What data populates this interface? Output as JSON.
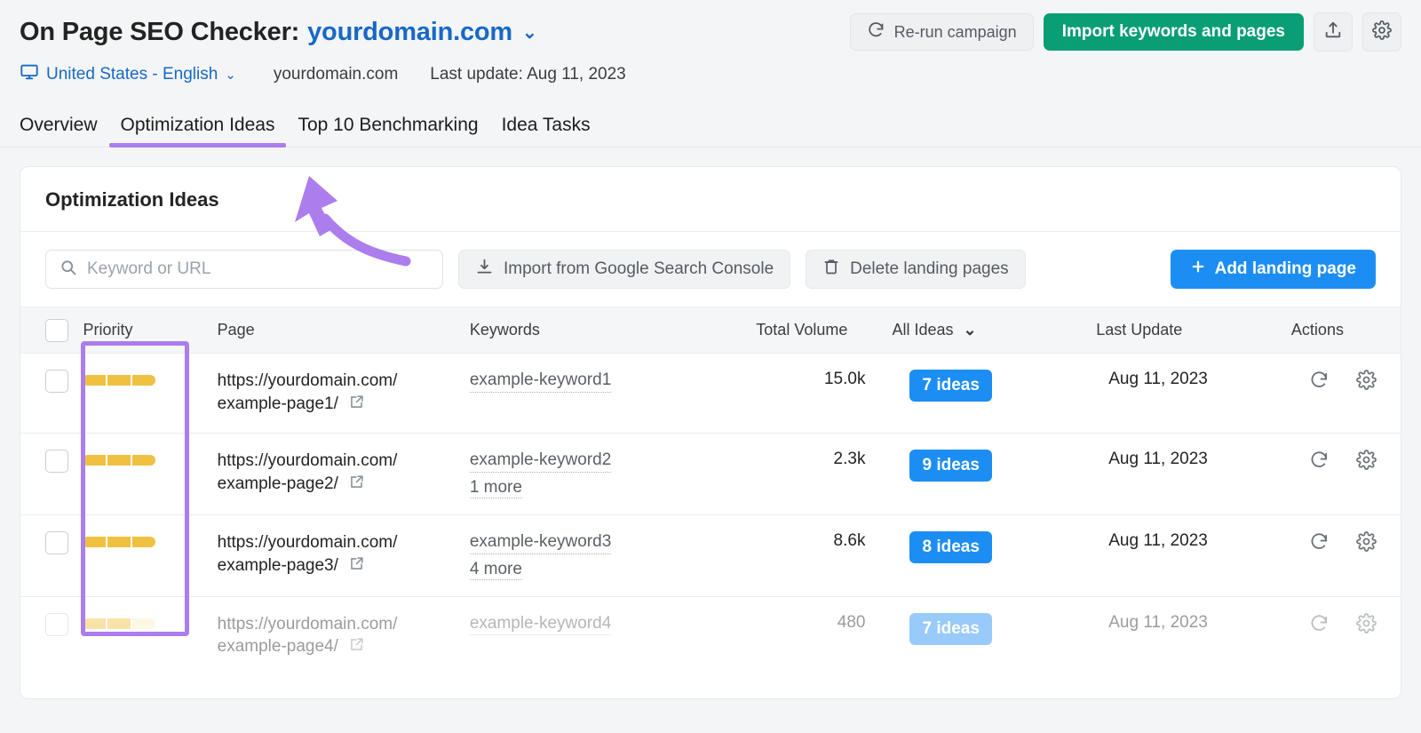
{
  "header": {
    "title_prefix": "On Page SEO Checker:",
    "domain": "yourdomain.com",
    "caret": "⌄",
    "rerun_label": "Re-run campaign",
    "import_label": "Import keywords and pages",
    "export_icon": "upload-icon",
    "settings_icon": "gear-icon"
  },
  "subheader": {
    "device_icon": "desktop-monitor-icon",
    "locale": "United States - English",
    "caret": "⌄",
    "domain": "yourdomain.com",
    "last_update": "Last update: Aug 11, 2023"
  },
  "tabs": [
    {
      "label": "Overview",
      "active": false
    },
    {
      "label": "Optimization Ideas",
      "active": true
    },
    {
      "label": "Top 10 Benchmarking",
      "active": false
    },
    {
      "label": "Idea Tasks",
      "active": false
    }
  ],
  "card": {
    "title": "Optimization Ideas",
    "toolbar": {
      "search_placeholder": "Keyword or URL",
      "search_value": "",
      "search_icon": "search-icon",
      "import_gsc_label": "Import from Google Search Console",
      "import_gsc_icon": "download-icon",
      "delete_label": "Delete landing pages",
      "delete_icon": "trash-icon",
      "add_label": "Add landing page",
      "add_icon": "plus-icon"
    },
    "columns": {
      "priority": "Priority",
      "page": "Page",
      "keywords": "Keywords",
      "total_volume": "Total Volume",
      "ideas_filter": "All Ideas",
      "ideas_filter_caret": "⌄",
      "last_update": "Last Update",
      "actions": "Actions"
    },
    "rows": [
      {
        "priority_filled": 3,
        "priority_total": 3,
        "page_line1": "https://yourdomain.com/",
        "page_line2": "example-page1/",
        "keyword": "example-keyword1",
        "more": "",
        "volume": "15.0k",
        "ideas": "7 ideas",
        "last_update": "Aug 11, 2023"
      },
      {
        "priority_filled": 3,
        "priority_total": 3,
        "page_line1": "https://yourdomain.com/",
        "page_line2": "example-page2/",
        "keyword": "example-keyword2",
        "more": "1 more",
        "volume": "2.3k",
        "ideas": "9 ideas",
        "last_update": "Aug 11, 2023"
      },
      {
        "priority_filled": 3,
        "priority_total": 3,
        "page_line1": "https://yourdomain.com/",
        "page_line2": "example-page3/",
        "keyword": "example-keyword3",
        "more": "4 more",
        "volume": "8.6k",
        "ideas": "8 ideas",
        "last_update": "Aug 11, 2023"
      },
      {
        "priority_filled": 2,
        "priority_total": 3,
        "page_line1": "https://yourdomain.com/",
        "page_line2": "example-page4/",
        "keyword": "example-keyword4",
        "more": "",
        "volume": "480",
        "ideas": "7 ideas",
        "last_update": "Aug 11, 2023"
      }
    ]
  },
  "annotations": {
    "highlight_color": "#ab7ded",
    "arrow_color": "#ab7ded",
    "highlight_target": "priority-column",
    "arrow_target": "tab-optimization-ideas"
  },
  "colors": {
    "accent_blue": "#1c8ef3",
    "link_blue": "#1769c6",
    "green": "#099e74",
    "priority_orange": "#f0c041",
    "purple": "#ab7ded",
    "page_bg": "#f4f5f7"
  }
}
